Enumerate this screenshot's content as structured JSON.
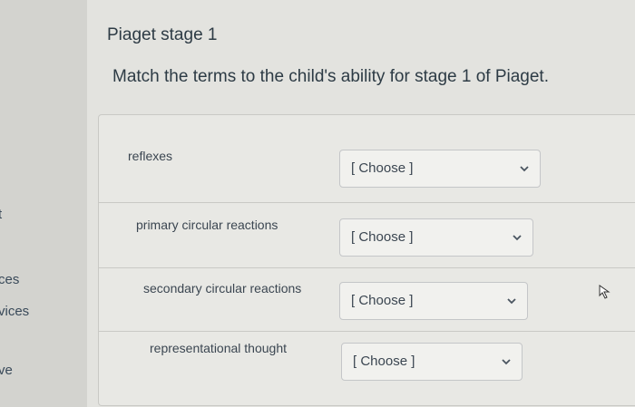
{
  "sidebar": {
    "items": [
      {
        "label": "t"
      },
      {
        "label": "ces"
      },
      {
        "label": "vices"
      },
      {
        "label": "ve"
      }
    ]
  },
  "question": {
    "title": "Piaget stage 1",
    "text": "Match the terms to the child's ability for stage 1 of Piaget."
  },
  "matches": [
    {
      "term": "reflexes",
      "selected": "[ Choose ]"
    },
    {
      "term": "primary circular reactions",
      "selected": "[ Choose ]"
    },
    {
      "term": "secondary circular reactions",
      "selected": "[ Choose ]"
    },
    {
      "term": "representational thought",
      "selected": "[ Choose ]"
    }
  ],
  "icons": {
    "dropdown": "chevron-down-icon",
    "cursor": "mouse-pointer-icon"
  }
}
